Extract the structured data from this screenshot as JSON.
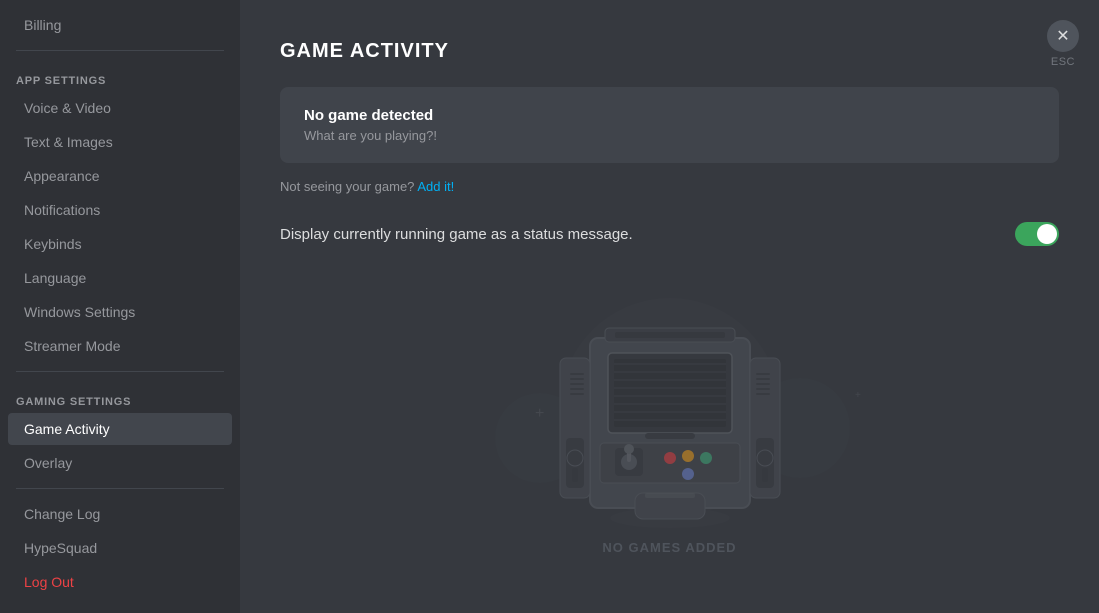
{
  "sidebar": {
    "app_settings_label": "App Settings",
    "gaming_settings_label": "Gaming Settings",
    "items": {
      "billing": "Billing",
      "voice_video": "Voice & Video",
      "text_images": "Text & Images",
      "appearance": "Appearance",
      "notifications": "Notifications",
      "keybinds": "Keybinds",
      "language": "Language",
      "windows_settings": "Windows Settings",
      "streamer_mode": "Streamer Mode",
      "game_activity": "Game Activity",
      "overlay": "Overlay",
      "change_log": "Change Log",
      "hypesquad": "HypeSquad",
      "log_out": "Log Out"
    }
  },
  "main": {
    "title": "Game Activity",
    "no_game_title": "No game detected",
    "no_game_subtitle": "What are you playing?!",
    "add_game_prompt": "Not seeing your game?",
    "add_game_link": "Add it!",
    "toggle_label": "Display currently running game as a status message.",
    "no_games_label": "No Games Added",
    "close_label": "✕",
    "esc_label": "ESC"
  },
  "colors": {
    "active_bg": "#42464d",
    "toggle_on": "#3ba55c",
    "link": "#00b0f4",
    "danger": "#ed4245"
  }
}
